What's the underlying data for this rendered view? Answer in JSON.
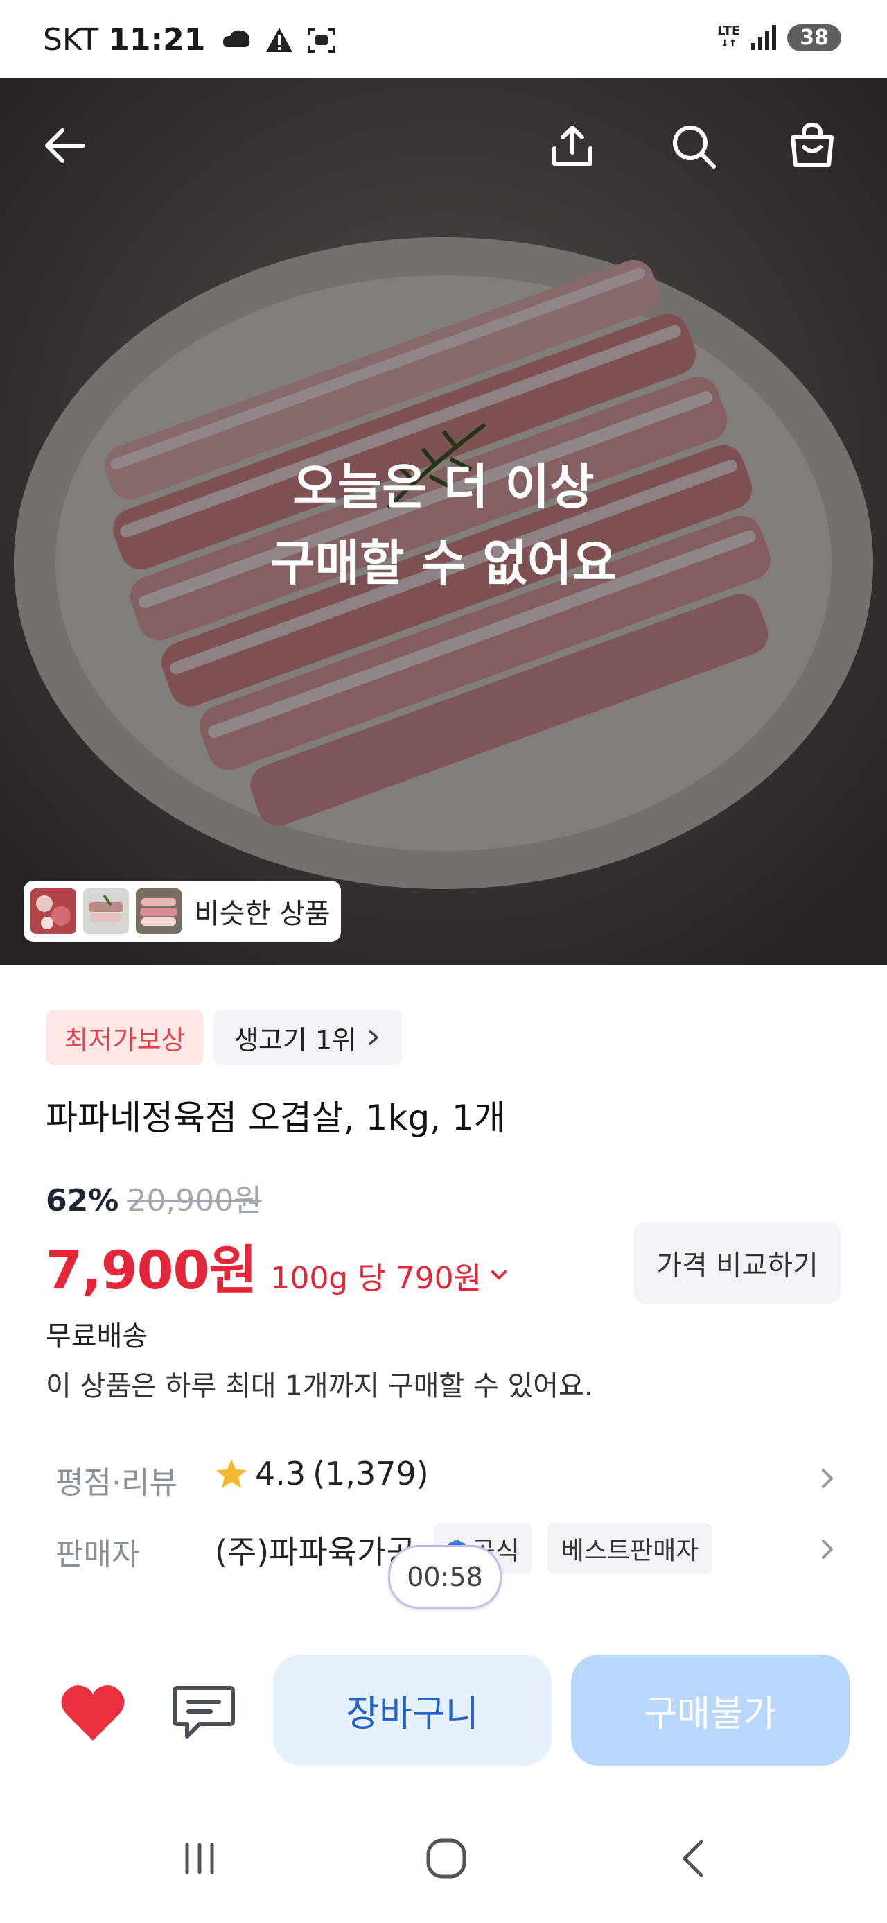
{
  "status_bar": {
    "carrier": "SKT",
    "time": "11:21",
    "network": "LTE",
    "battery": "38"
  },
  "hero": {
    "soldout_line1": "오늘은 더 이상",
    "soldout_line2": "구매할 수 없어요",
    "similar_label": "비슷한 상품"
  },
  "product": {
    "badge_lowest": "최저가보상",
    "badge_rank": "생고기 1위",
    "title": "파파네정육점 오겹살, 1kg, 1개",
    "discount": "62%",
    "original_price": "20,900원",
    "price": "7,900원",
    "unit_price": "100g 당 790원",
    "compare_label": "가격 비교하기",
    "shipping": "무료배송",
    "limit_notice": "이 상품은 하루 최대 1개까지 구매할 수 있어요."
  },
  "rating": {
    "label": "평점·리뷰",
    "score": "4.3",
    "count": "(1,379)"
  },
  "seller": {
    "label": "판매자",
    "name": "(주)파파육가공",
    "official": "공식",
    "best": "베스트판매자"
  },
  "timer": "00:58",
  "actions": {
    "cart": "장바구니",
    "buy": "구매불가"
  },
  "colors": {
    "accent_red": "#e3263a",
    "accent_blue": "#2563cc",
    "buy_disabled": "#b9d6fb"
  }
}
